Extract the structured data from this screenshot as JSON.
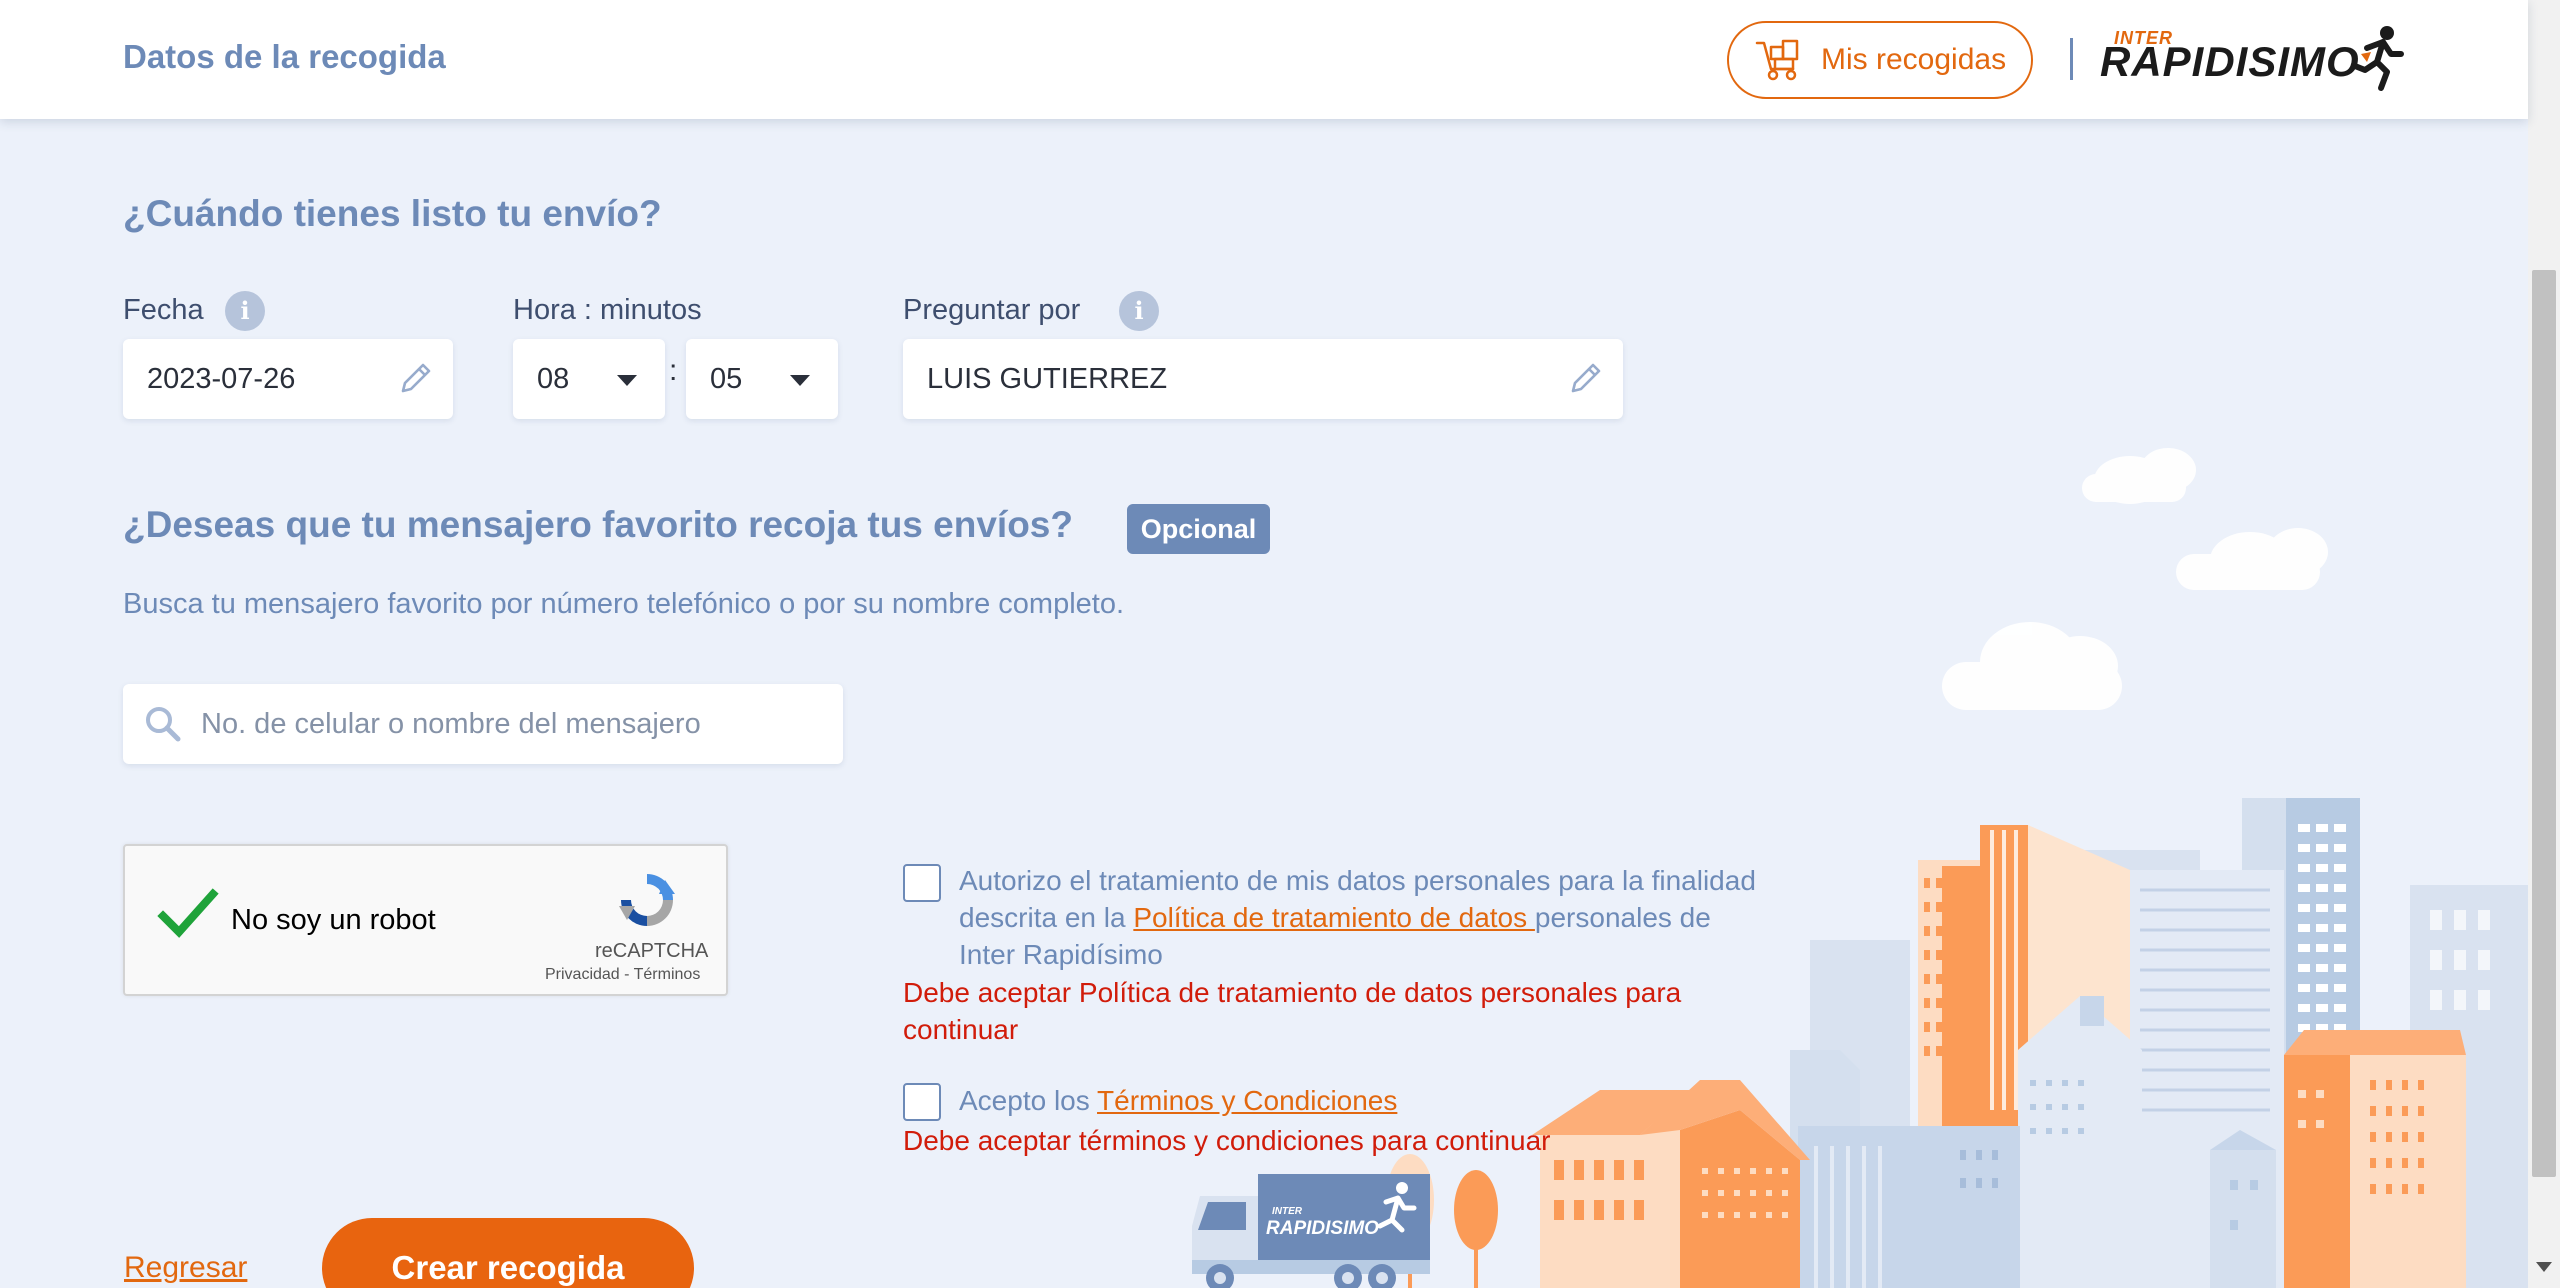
{
  "header": {
    "title": "Datos de la recogida",
    "mis_recogidas_label": "Mis recogidas",
    "logo_top": "INTER",
    "logo_main": "RAPIDISIMO"
  },
  "when": {
    "title": "¿Cuándo tienes listo tu envío?",
    "date_label": "Fecha",
    "date_value": "2023-07-26",
    "time_label": "Hora : minutos",
    "hour_value": "08",
    "time_separator": ":",
    "minute_value": "05",
    "ask_for_label": "Preguntar por",
    "ask_for_value": "LUIS GUTIERREZ"
  },
  "messenger": {
    "title": "¿Deseas que tu mensajero favorito recoja tus envíos?",
    "badge": "Opcional",
    "subtitle": "Busca tu mensajero favorito por número telefónico o por su nombre completo.",
    "search_placeholder": "No. de celular o nombre del mensajero"
  },
  "captcha": {
    "label": "No soy un robot",
    "brand": "reCAPTCHA",
    "links": "Privacidad - Términos"
  },
  "consents": {
    "privacy_line1": "Autorizo el tratamiento de mis datos personales para la finalidad",
    "privacy_pre": "descrita en la ",
    "privacy_link": "Política de tratamiento de datos ",
    "privacy_post": "personales de",
    "privacy_line3": "Inter Rapidísimo",
    "privacy_error_line1": "Debe aceptar Política de tratamiento de datos personales para",
    "privacy_error_line2": "continuar",
    "terms_pre": "Acepto los ",
    "terms_link": "Términos y Condiciones",
    "terms_error": "Debe aceptar términos y condiciones para continuar"
  },
  "actions": {
    "back_label": "Regresar",
    "create_label": "Crear recogida"
  },
  "illustration": {
    "truck_logo_top": "INTER",
    "truck_logo_main": "RAPIDISIMO"
  },
  "colors": {
    "accent": "#e2680f",
    "primary": "#6d8ab7",
    "error": "#d11c0a",
    "background": "#ecf1fa"
  }
}
